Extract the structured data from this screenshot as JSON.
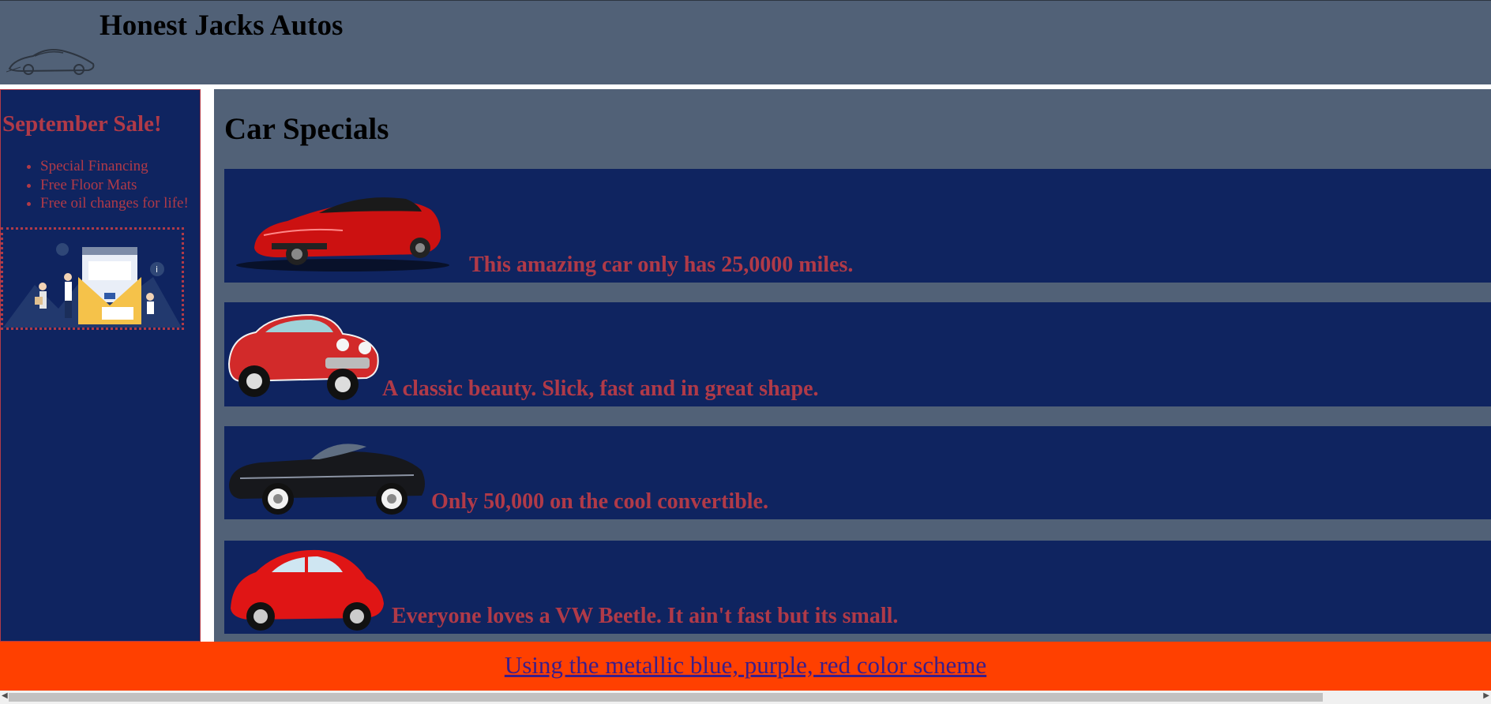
{
  "header": {
    "title": "Honest Jacks Autos",
    "logo_icon": "car-sketch-logo"
  },
  "sidebar": {
    "sale_title": "September Sale!",
    "perks": [
      "Special Financing",
      "Free Floor Mats",
      "Free oil changes for life!"
    ],
    "promo_image": "office-illustration"
  },
  "main": {
    "title": "Car Specials",
    "cards": [
      {
        "caption": "This amazing car only has 25,0000 miles.",
        "image": "red-sports-car"
      },
      {
        "caption": "A classic beauty. Slick, fast and in great shape.",
        "image": "red-classic-corvette"
      },
      {
        "caption": "Only 50,000 on the cool convertible.",
        "image": "black-vintage-convertible"
      },
      {
        "caption": "Everyone loves a VW Beetle. It ain't fast but its small.",
        "image": "red-vw-beetle"
      }
    ]
  },
  "footer": {
    "link_text": "Using the metallic blue, purple, red color scheme"
  },
  "colors": {
    "header_bg": "#516177",
    "panel_bg": "#0f2460",
    "accent_red": "#b03a48",
    "footer_bg": "#ff4000",
    "link": "#3b1e8a"
  }
}
